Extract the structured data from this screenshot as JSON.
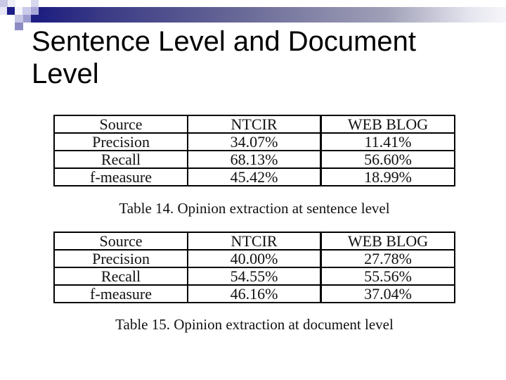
{
  "slide": {
    "title": "Sentence Level and Document Level"
  },
  "tables": [
    {
      "headers": [
        "Source",
        "NTCIR",
        "WEB BLOG"
      ],
      "rows": [
        [
          "Precision",
          "34.07%",
          "11.41%"
        ],
        [
          "Recall",
          "68.13%",
          "56.60%"
        ],
        [
          "f-measure",
          "45.42%",
          "18.99%"
        ]
      ],
      "caption": "Table 14. Opinion extraction at sentence level"
    },
    {
      "headers": [
        "Source",
        "NTCIR",
        "WEB BLOG"
      ],
      "rows": [
        [
          "Precision",
          "40.00%",
          "27.78%"
        ],
        [
          "Recall",
          "54.55%",
          "55.56%"
        ],
        [
          "f-measure",
          "46.16%",
          "37.04%"
        ]
      ],
      "caption": "Table 15. Opinion extraction at document level"
    }
  ],
  "theme": {
    "accent_dark": "#1a1a80",
    "accent_light": "#c8c8e6"
  }
}
